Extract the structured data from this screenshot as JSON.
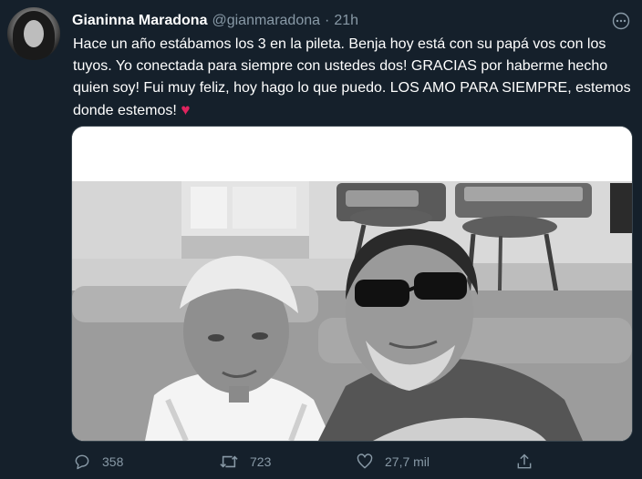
{
  "user": {
    "name": "Gianinna Maradona",
    "handle": "@gianmaradona",
    "separator": "·",
    "time": "21h"
  },
  "tweet": {
    "text": "Hace un año estábamos los 3 en la pileta. Benja hoy está con su papá vos con los tuyos. Yo conectada para siempre con ustedes dos! GRACIAS por haberme hecho quien soy! Fui muy feliz, hoy hago lo que puedo. LOS AMO PARA SIEMPRE, estemos donde estemos!",
    "emoji": "♥"
  },
  "actions": {
    "replies": "358",
    "retweets": "723",
    "likes": "27,7 mil"
  },
  "icons": {
    "more": "more-icon",
    "reply": "reply-icon",
    "retweet": "retweet-icon",
    "like": "like-icon",
    "share": "share-icon"
  },
  "colors": {
    "background": "#15202b",
    "secondary_text": "#8899a6",
    "heart": "#e0245e"
  }
}
